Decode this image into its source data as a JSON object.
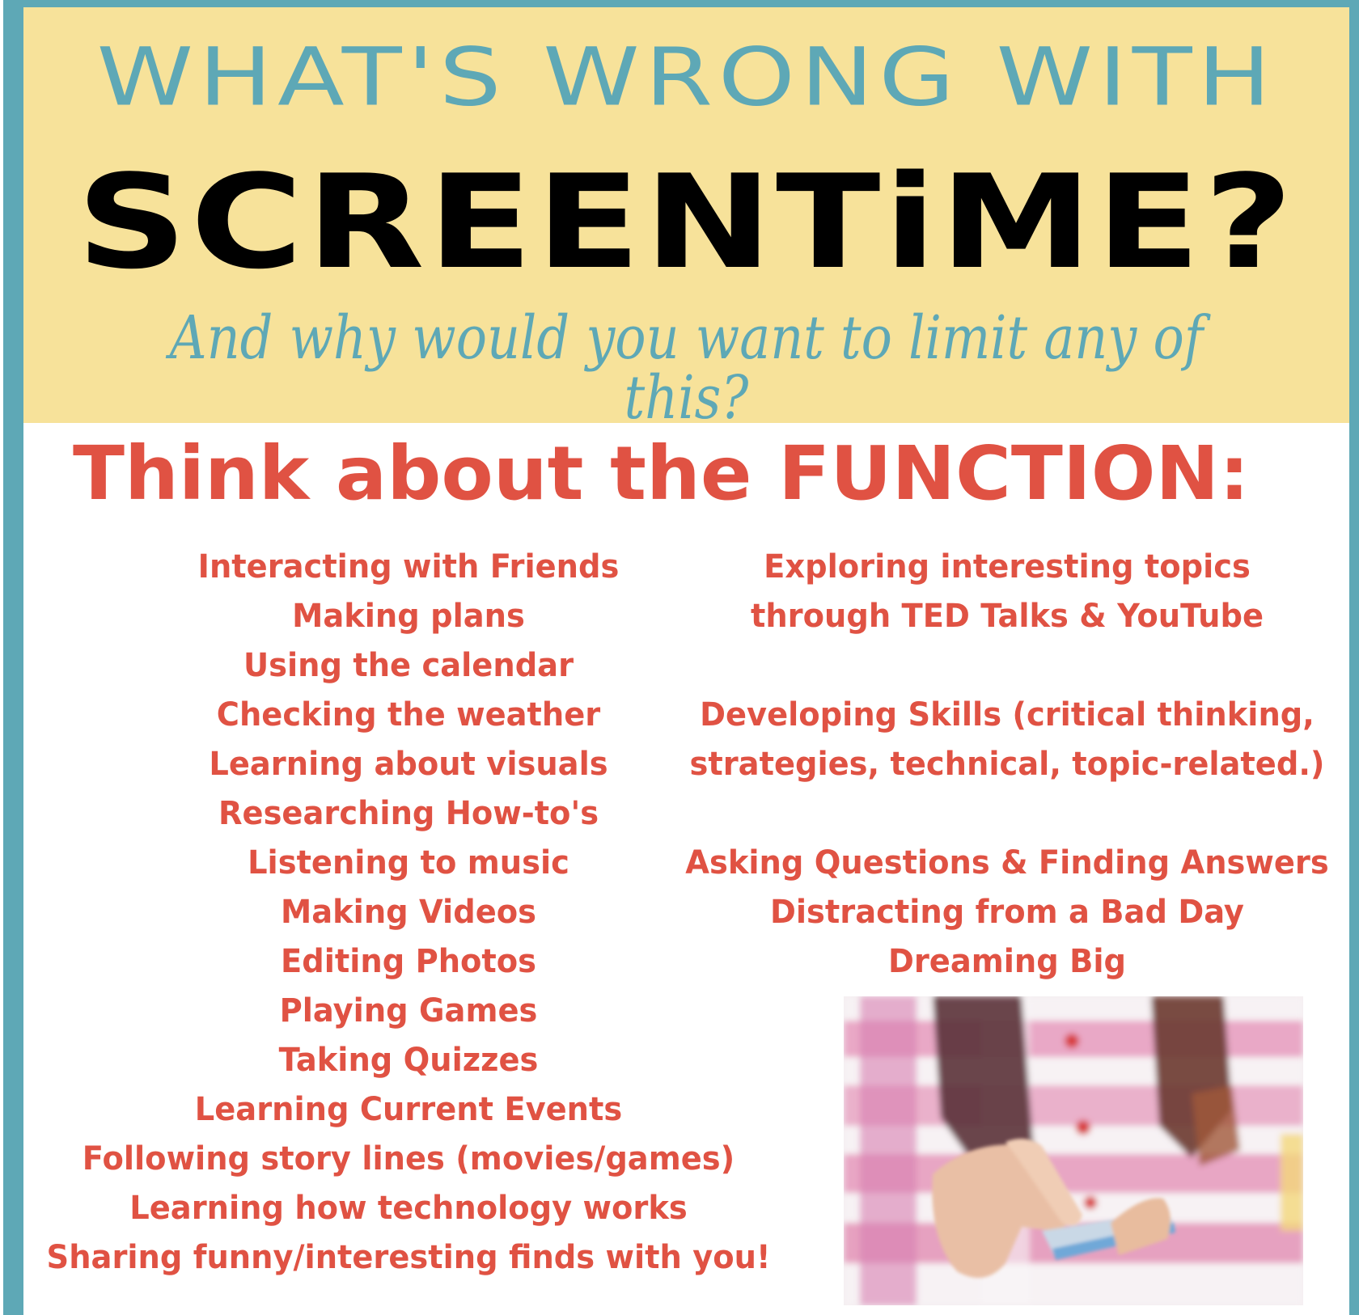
{
  "colors": {
    "frame": "#5ea8b6",
    "header_background": "#f7e29a",
    "headline_accent": "#5ea8b6",
    "headline_main": "#000000",
    "body_text": "#e05243"
  },
  "header": {
    "line1": "WHAT'S WRONG WITH",
    "line2": "SCREENTiME?",
    "subtitle": "And why would you want to limit any of this?"
  },
  "section": {
    "title": "Think about the FUNCTION:"
  },
  "left_list": [
    "Interacting with Friends",
    "Making plans",
    "Using the calendar",
    "Checking the weather",
    "Learning about visuals",
    "Researching How-to's",
    "Listening to music",
    "Making Videos",
    "Editing Photos",
    "Playing Games",
    "Taking Quizzes",
    "Learning Current Events",
    "Following story lines (movies/games)",
    "Learning how technology works",
    "Sharing funny/interesting finds with you!"
  ],
  "right_list": {
    "group1": [
      "Exploring interesting topics",
      "through TED Talks & YouTube"
    ],
    "group2": [
      "Developing Skills (critical thinking,",
      "strategies, technical, topic-related.)"
    ],
    "group3": [
      "Asking Questions & Finding Answers",
      "Distracting from a Bad Day",
      "Dreaming Big"
    ]
  },
  "photo": {
    "description": "Child in pink and white striped shirt pointing at a smartphone"
  }
}
